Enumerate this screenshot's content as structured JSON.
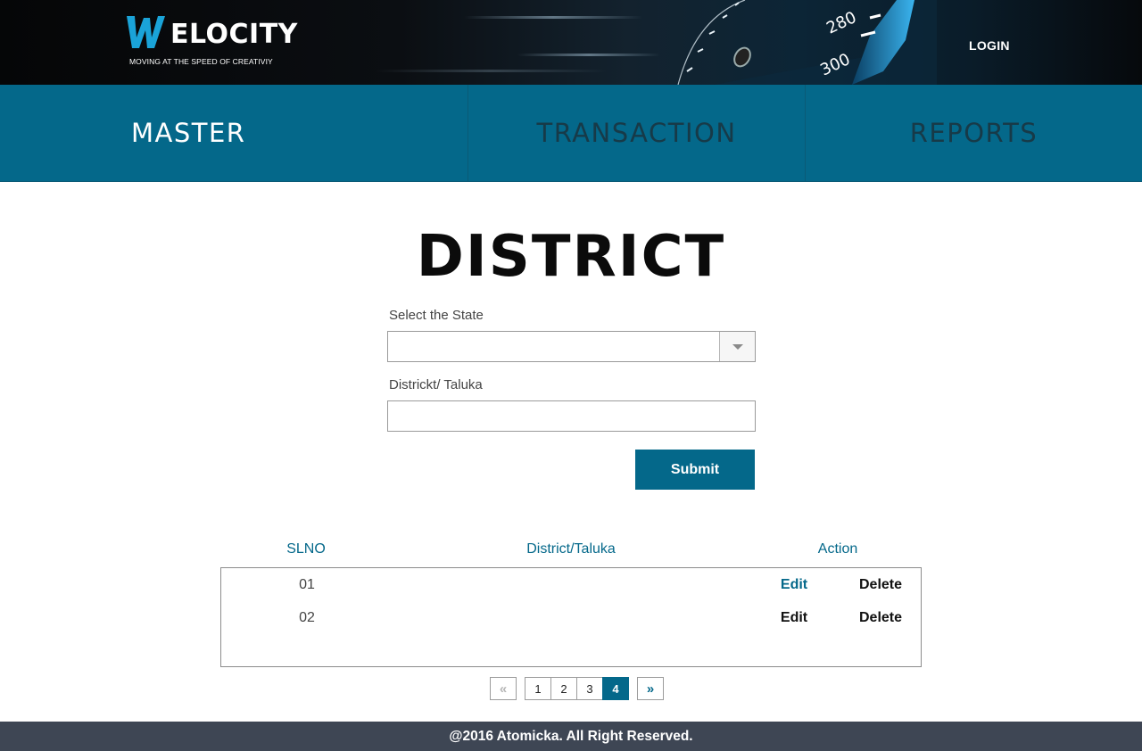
{
  "header": {
    "logo": {
      "word": "ELOCITY",
      "tagline": "MOVING AT THE SPEED OF CREATIVIY"
    },
    "speedometer": {
      "labels": [
        "280",
        "300"
      ]
    },
    "login_label": "LOGIN"
  },
  "nav": {
    "tabs": [
      {
        "label": "MASTER",
        "active": true
      },
      {
        "label": "TRANSACTION",
        "active": false
      },
      {
        "label": "REPORTS",
        "active": false
      }
    ]
  },
  "page": {
    "title": "DISTRICT"
  },
  "form": {
    "state_label": "Select the State",
    "state_value": "",
    "district_label": "Districkt/ Taluka",
    "district_value": "",
    "submit_label": "Submit"
  },
  "table": {
    "headers": {
      "slno": "SLNO",
      "district": "District/Taluka",
      "action": "Action"
    },
    "rows": [
      {
        "slno": "01",
        "district": "",
        "edit": "Edit",
        "delete": "Delete"
      },
      {
        "slno": "02",
        "district": "",
        "edit": "Edit",
        "delete": "Delete"
      }
    ]
  },
  "pagination": {
    "first": "«",
    "last": "»",
    "pages": [
      "1",
      "2",
      "3",
      "4"
    ],
    "current": "4"
  },
  "footer": {
    "text": "@2016 Atomicka. All Right Reserved."
  },
  "colors": {
    "primary": "#04688a",
    "footer": "#3e4654",
    "header_dark": "#050607"
  },
  "icons": {
    "select_caret": "caret-down-icon",
    "logo_mark": "w-logo-icon"
  }
}
